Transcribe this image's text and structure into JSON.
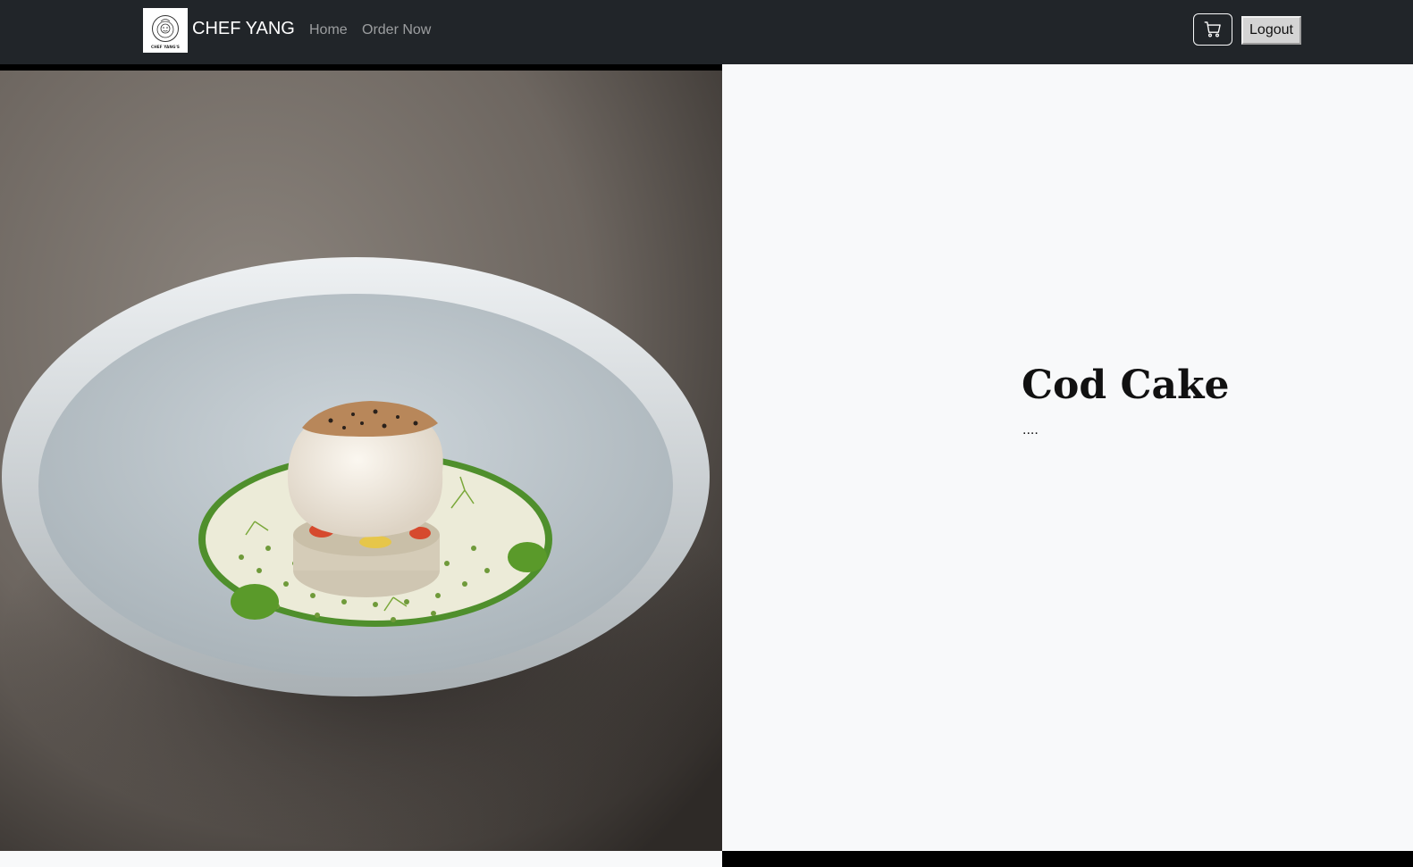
{
  "navbar": {
    "brand_logo_text": "CHEF YANG'S",
    "brand_name": "CHEF YANG",
    "links": [
      "Home",
      "Order Now"
    ],
    "cart_icon": "cart-icon",
    "logout_label": "Logout"
  },
  "dish": {
    "title": "Cod Cake",
    "description": "...."
  },
  "colors": {
    "navbar_bg": "#212529",
    "page_bg": "#f8f9fa"
  }
}
